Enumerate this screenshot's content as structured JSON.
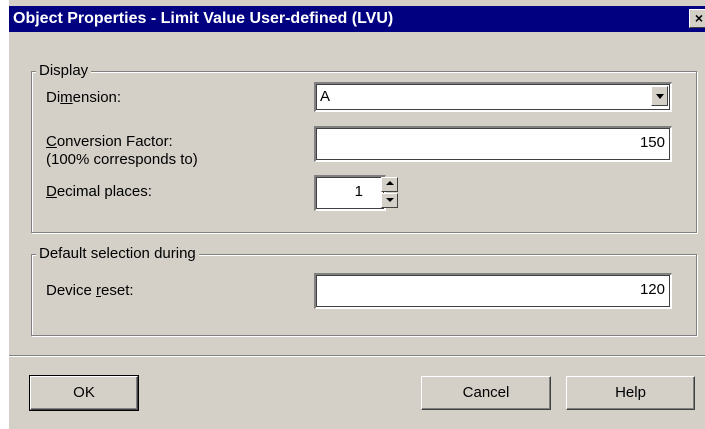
{
  "window": {
    "title": "Object Properties - Limit Value User-defined (LVU)",
    "close_glyph": "×"
  },
  "display_group": {
    "legend": "Display",
    "dimension": {
      "label_pre": "Di",
      "label_mnemonic": "m",
      "label_post": "ension:",
      "value": "A"
    },
    "conversion_factor": {
      "label_mnemonic": "C",
      "label_post": "onversion Factor:",
      "sub_label": "(100% corresponds to)",
      "value": "150"
    },
    "decimal_places": {
      "label_mnemonic": "D",
      "label_post": "ecimal places:",
      "value": "1"
    }
  },
  "default_group": {
    "legend": "Default selection during",
    "device_reset": {
      "label_pre": "Device ",
      "label_mnemonic": "r",
      "label_post": "eset:",
      "value": "120"
    }
  },
  "buttons": {
    "ok": "OK",
    "cancel": "Cancel",
    "help": "Help"
  },
  "colors": {
    "title_bar": "#000080",
    "dialog_face": "#d4d0c8",
    "field_bg": "#ffffff"
  },
  "icons": {
    "dropdown": "chevron-down-icon",
    "spin_up": "arrow-up-icon",
    "spin_down": "arrow-down-icon",
    "close": "close-icon"
  }
}
